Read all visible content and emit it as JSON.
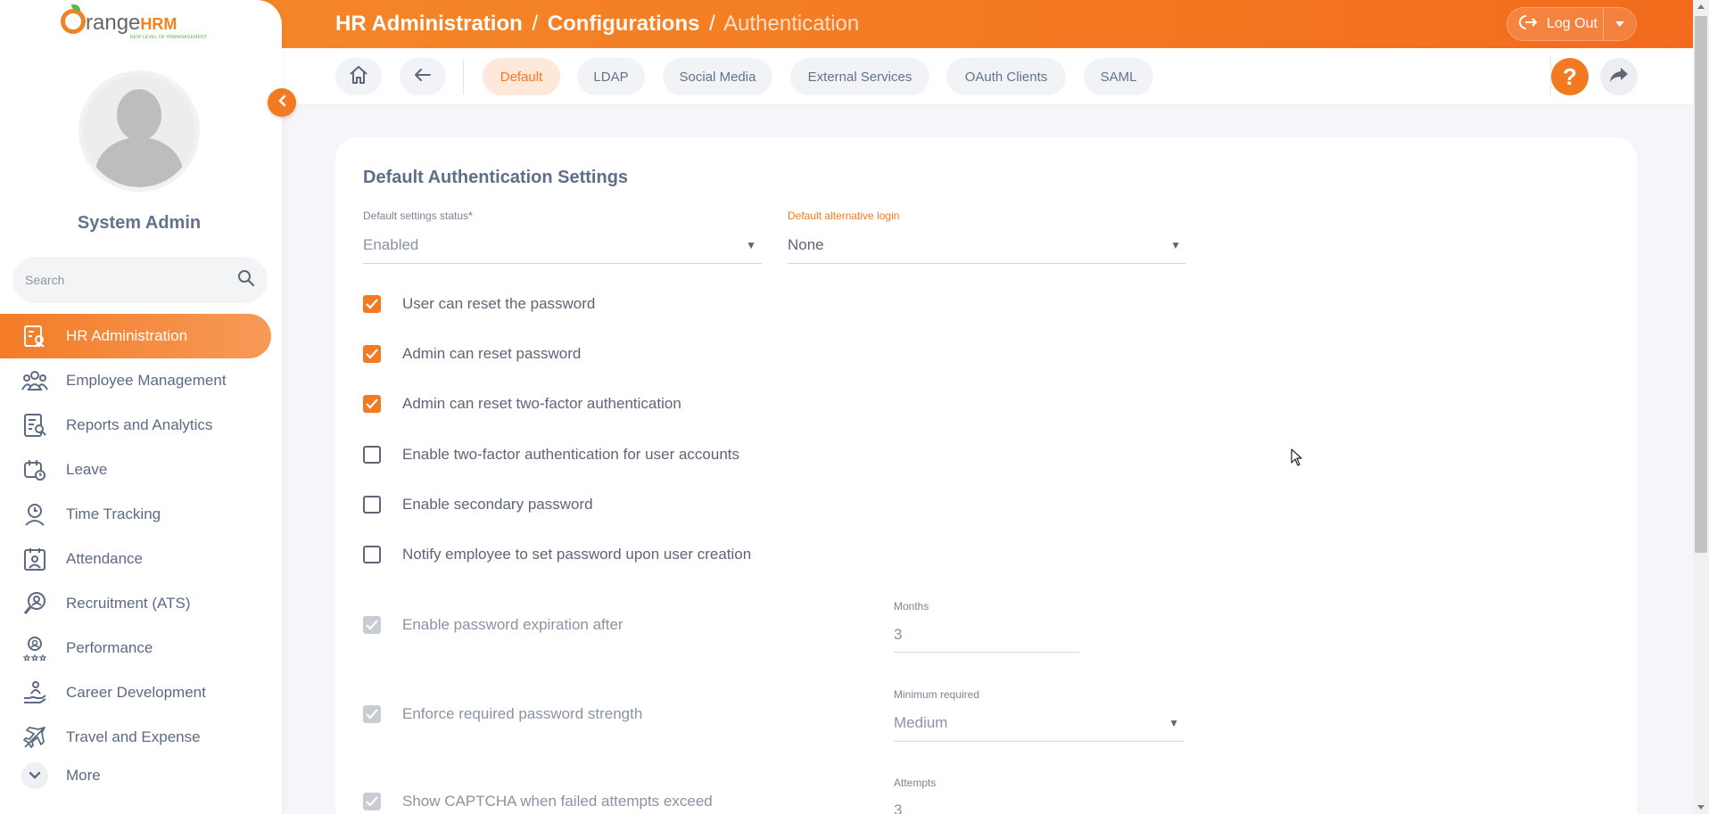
{
  "app": {
    "logo_text_prefix": "O",
    "logo_text_main": "range",
    "logo_text_brand": "HRM",
    "logo_tagline": "NEW LEVEL OF HRMANAGEMENT"
  },
  "header": {
    "crumb_1": "HR Administration",
    "crumb_2": "Configurations",
    "crumb_3": "Authentication",
    "separator": "/",
    "logout_label": "Log Out"
  },
  "sidebar": {
    "user_name": "System Admin",
    "search_placeholder": "Search",
    "items": [
      {
        "label": "HR Administration",
        "icon": "hr-admin-icon",
        "active": true
      },
      {
        "label": "Employee Management",
        "icon": "employee-management-icon",
        "active": false
      },
      {
        "label": "Reports and Analytics",
        "icon": "reports-icon",
        "active": false
      },
      {
        "label": "Leave",
        "icon": "leave-icon",
        "active": false
      },
      {
        "label": "Time Tracking",
        "icon": "time-tracking-icon",
        "active": false
      },
      {
        "label": "Attendance",
        "icon": "attendance-icon",
        "active": false
      },
      {
        "label": "Recruitment (ATS)",
        "icon": "recruitment-icon",
        "active": false
      },
      {
        "label": "Performance",
        "icon": "performance-icon",
        "active": false
      },
      {
        "label": "Career Development",
        "icon": "career-development-icon",
        "active": false
      },
      {
        "label": "Travel and Expense",
        "icon": "travel-icon",
        "active": false
      }
    ],
    "more_label": "More"
  },
  "tabs": [
    {
      "label": "Default",
      "active": true
    },
    {
      "label": "LDAP",
      "active": false
    },
    {
      "label": "Social Media",
      "active": false
    },
    {
      "label": "External Services",
      "active": false
    },
    {
      "label": "OAuth Clients",
      "active": false
    },
    {
      "label": "SAML",
      "active": false
    }
  ],
  "form": {
    "title": "Default Authentication Settings",
    "status_label": "Default settings status",
    "status_required_mark": "*",
    "status_value": "Enabled",
    "alt_login_label": "Default alternative login",
    "alt_login_value": "None",
    "checkboxes": [
      {
        "label": "User can reset the password",
        "checked": true
      },
      {
        "label": "Admin can reset password",
        "checked": true
      },
      {
        "label": "Admin can reset two-factor authentication",
        "checked": true
      },
      {
        "label": "Enable two-factor authentication for user accounts",
        "checked": false
      },
      {
        "label": "Enable secondary password",
        "checked": false
      },
      {
        "label": "Notify employee to set password upon user creation",
        "checked": false
      }
    ],
    "expiration": {
      "label": "Enable password expiration after",
      "field_label": "Months",
      "value": "3",
      "checked": true,
      "disabled": true
    },
    "strength": {
      "label": "Enforce required password strength",
      "field_label": "Minimum required",
      "value": "Medium",
      "checked": true,
      "disabled": true
    },
    "captcha": {
      "label": "Show CAPTCHA when failed attempts exceed",
      "field_label": "Attempts",
      "value": "3",
      "checked": true,
      "disabled": true
    }
  },
  "colors": {
    "accent": "#f47a22",
    "text": "#64728c",
    "active_tab_bg": "#fde8d9"
  }
}
